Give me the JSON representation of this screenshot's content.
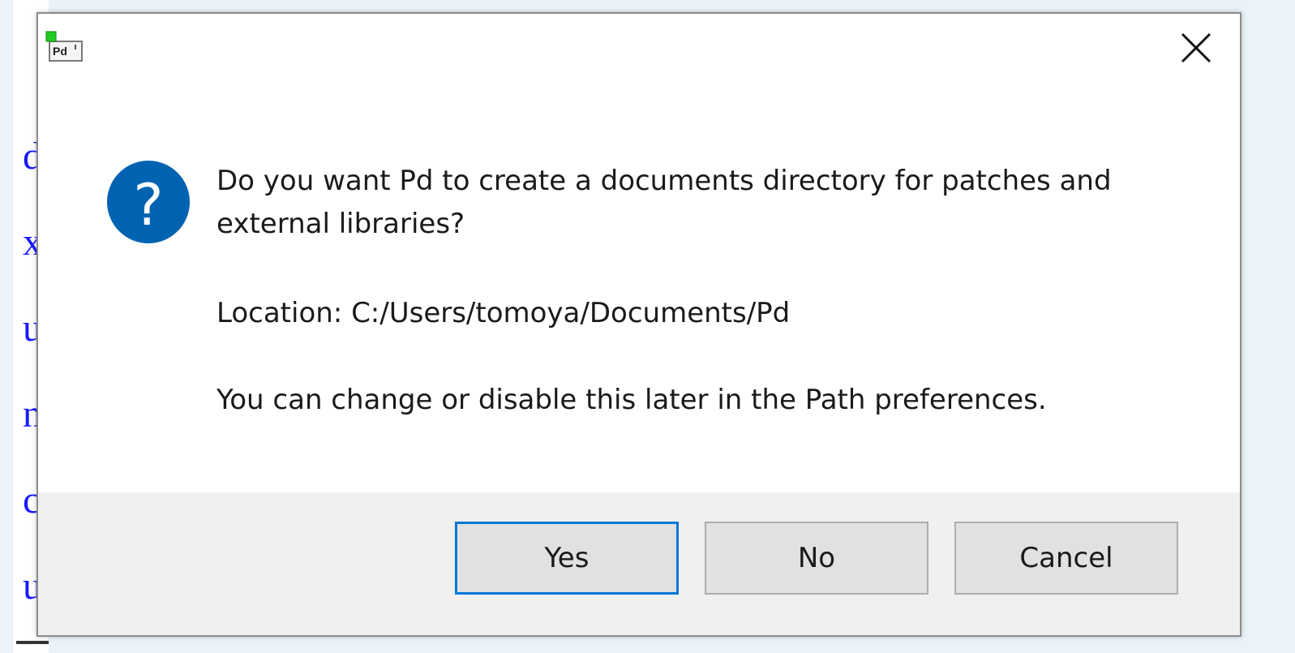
{
  "background": {
    "visible_fragments": [
      "d",
      "x",
      "u",
      "n",
      "c",
      "u"
    ]
  },
  "dialog": {
    "app_icon_label": "Pd",
    "message_line": "Do you want Pd to create a documents directory for patches and external libraries?",
    "location": "Location: C:/Users/tomoya/Documents/Pd",
    "note": "You can change or disable this later in the Path preferences.",
    "buttons": {
      "yes": "Yes",
      "no": "No",
      "cancel": "Cancel"
    },
    "icon": "question-icon",
    "colors": {
      "accent": "#0078d7",
      "question_icon_bg": "#0063b1",
      "background_text": "#1a1aff"
    }
  }
}
